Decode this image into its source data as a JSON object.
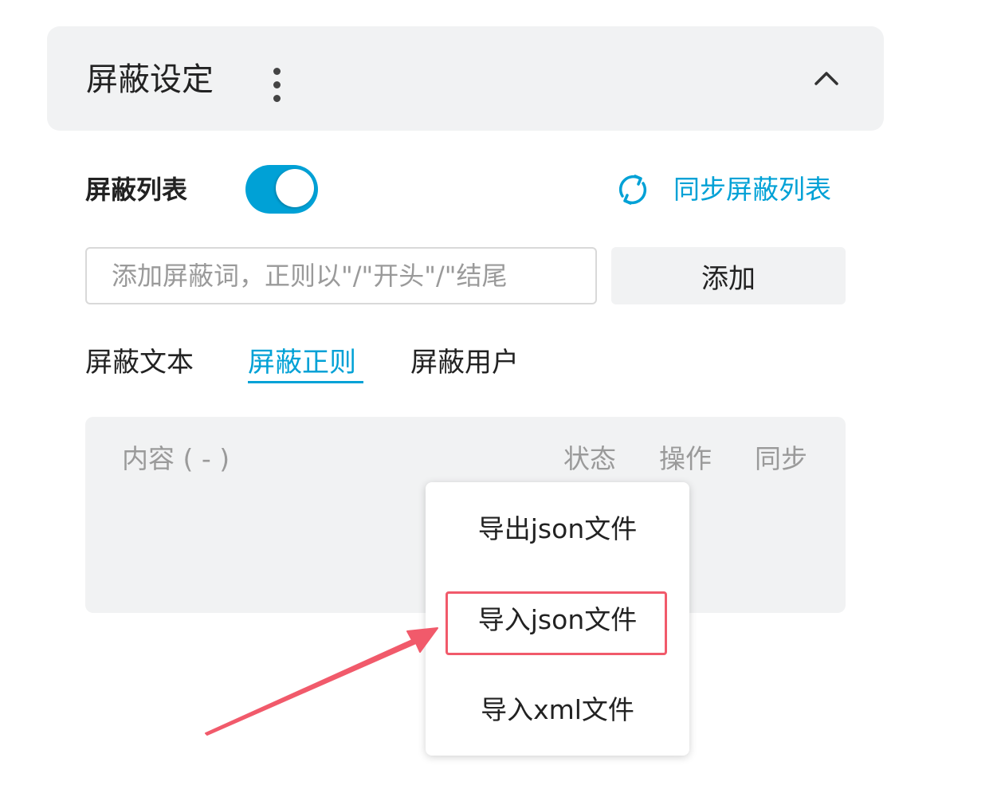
{
  "panel": {
    "title": "屏蔽设定"
  },
  "block_list": {
    "title": "屏蔽列表",
    "enabled": true,
    "sync_label": "同步屏蔽列表"
  },
  "add_form": {
    "placeholder": "添加屏蔽词，正则以\"/\"开头\"/\"结尾",
    "value": "",
    "add_label": "添加"
  },
  "tabs": [
    {
      "label": "屏蔽文本",
      "active": false
    },
    {
      "label": "屏蔽正则",
      "active": true
    },
    {
      "label": "屏蔽用户",
      "active": false
    }
  ],
  "table": {
    "headers": {
      "content": "内容 ( - )",
      "status": "状态",
      "action": "操作",
      "sync": "同步"
    }
  },
  "menu": {
    "items": [
      {
        "label": "导出json文件"
      },
      {
        "label": "导入json文件",
        "highlighted": true
      },
      {
        "label": "导入xml文件"
      }
    ]
  },
  "colors": {
    "accent": "#00a1d6",
    "panel_bg": "#f1f2f3",
    "annotation": "#f15a6b",
    "muted_text": "#9a9a9a"
  },
  "icons": [
    "more-vertical-icon",
    "chevron-up-icon",
    "sync-icon"
  ]
}
